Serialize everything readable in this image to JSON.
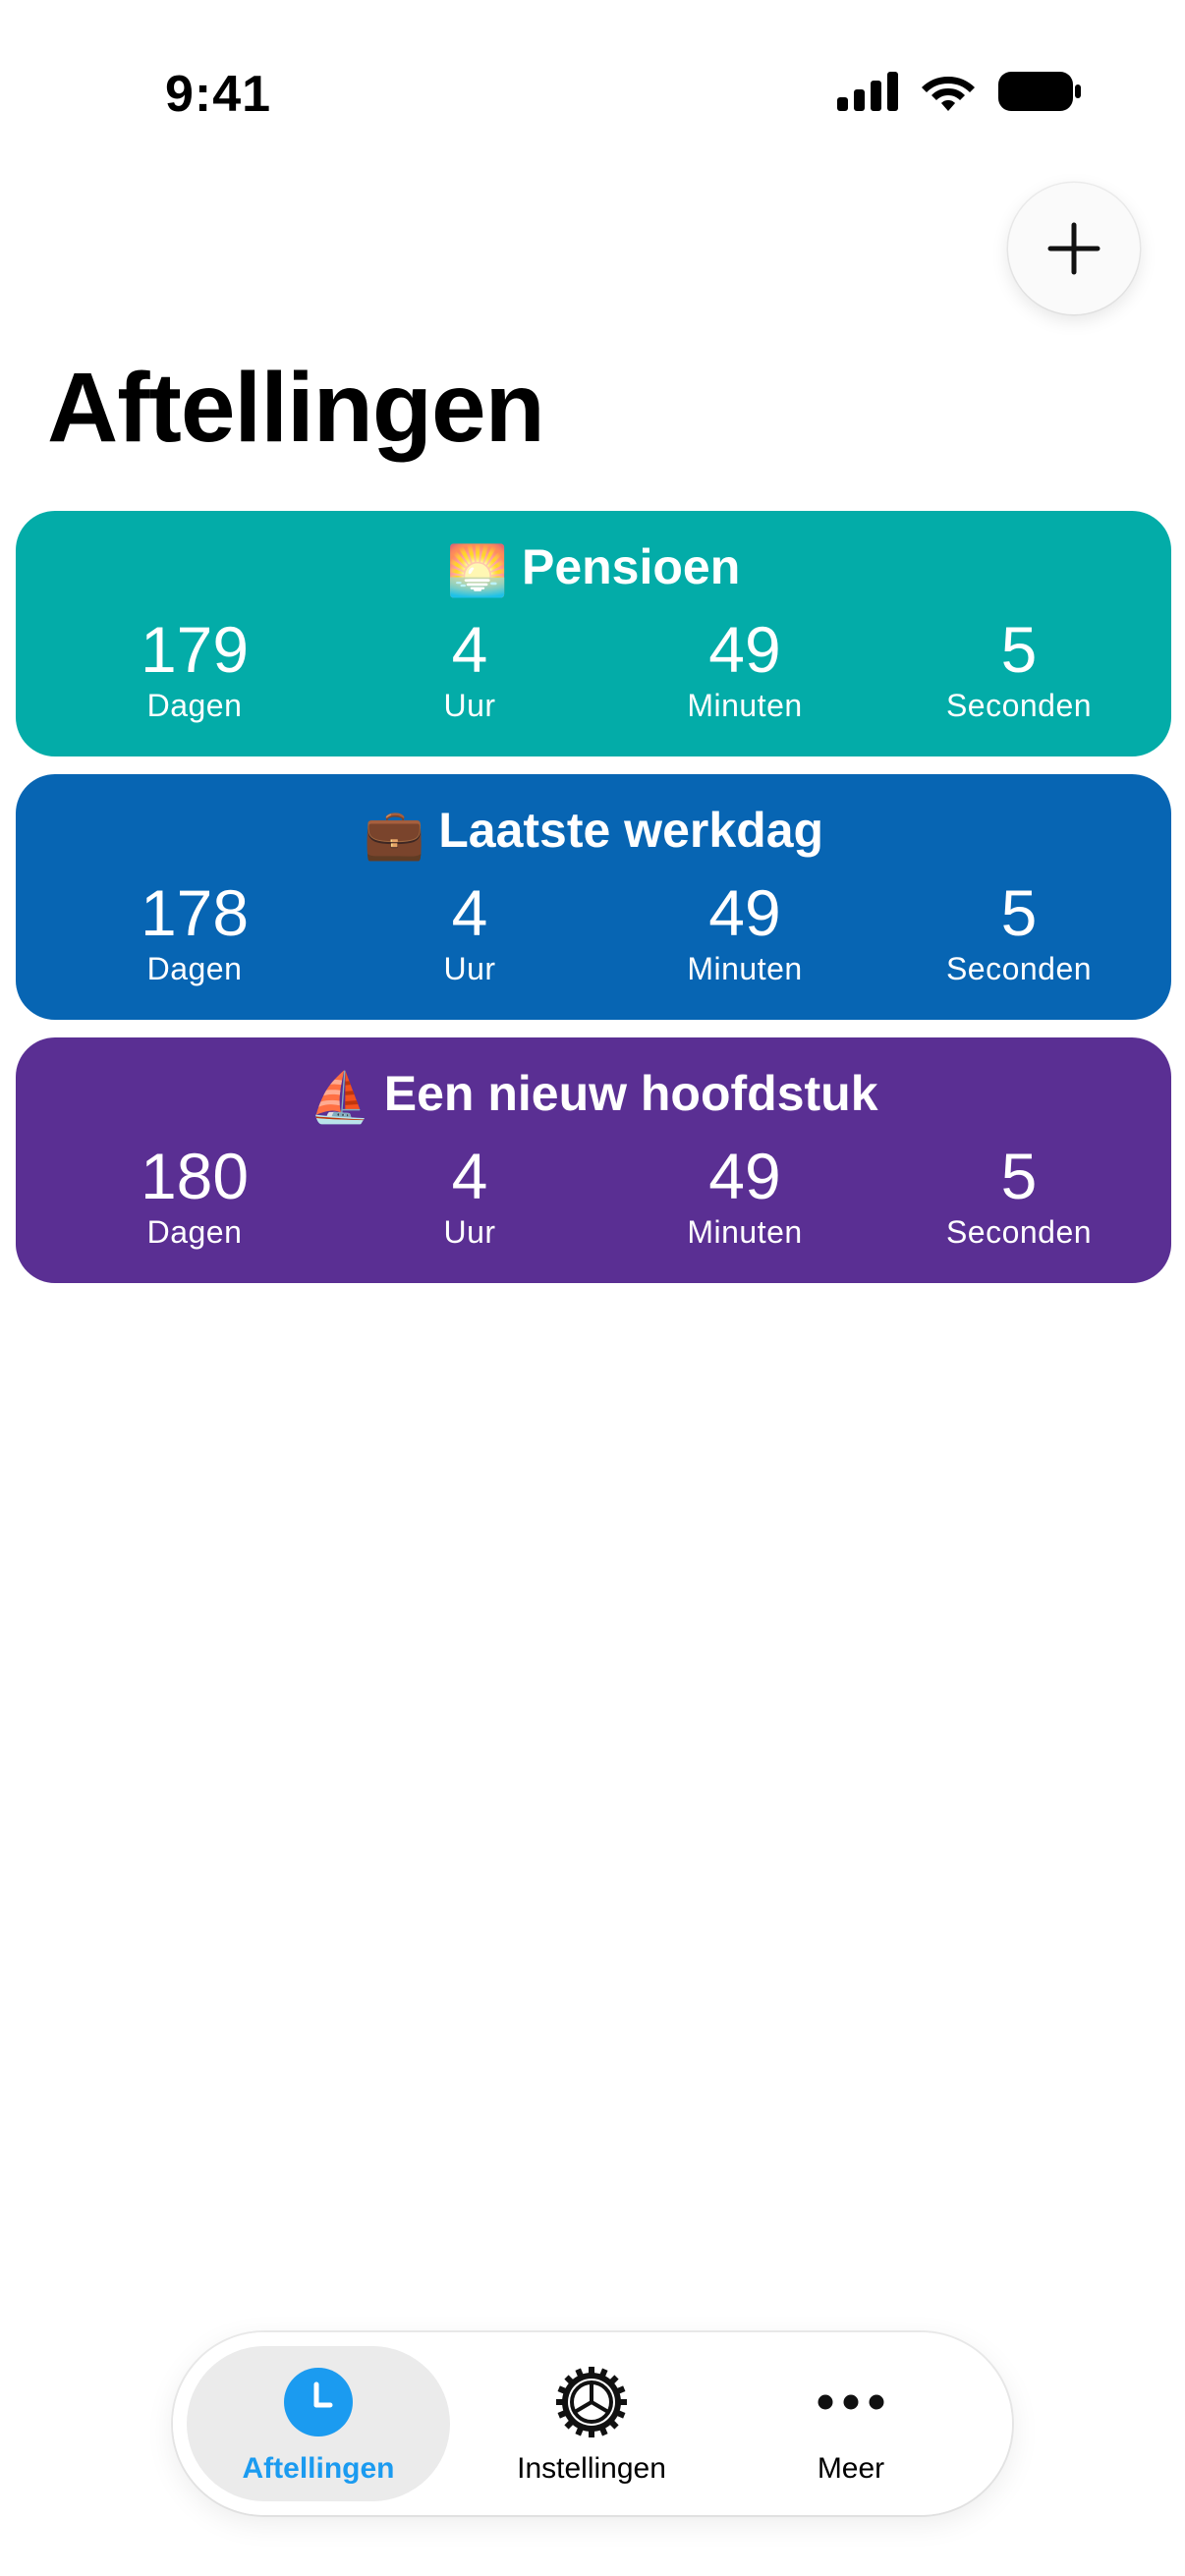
{
  "status_bar": {
    "time": "9:41"
  },
  "header": {
    "title": "Aftellingen",
    "add_icon": "plus-icon"
  },
  "countdowns": [
    {
      "emoji": "🌅",
      "title": "Pensioen",
      "color": "#03ACA8",
      "units": [
        {
          "value": "179",
          "label": "Dagen"
        },
        {
          "value": "4",
          "label": "Uur"
        },
        {
          "value": "49",
          "label": "Minuten"
        },
        {
          "value": "5",
          "label": "Seconden"
        }
      ]
    },
    {
      "emoji": "💼",
      "title": "Laatste werkdag",
      "color": "#0765B3",
      "units": [
        {
          "value": "178",
          "label": "Dagen"
        },
        {
          "value": "4",
          "label": "Uur"
        },
        {
          "value": "49",
          "label": "Minuten"
        },
        {
          "value": "5",
          "label": "Seconden"
        }
      ]
    },
    {
      "emoji": "⛵",
      "title": "Een nieuw hoofdstuk",
      "color": "#5A2F93",
      "units": [
        {
          "value": "180",
          "label": "Dagen"
        },
        {
          "value": "4",
          "label": "Uur"
        },
        {
          "value": "49",
          "label": "Minuten"
        },
        {
          "value": "5",
          "label": "Seconden"
        }
      ]
    }
  ],
  "tab_bar": {
    "active_color": "#1B9BF0",
    "tabs": [
      {
        "label": "Aftellingen",
        "icon": "clock-icon",
        "active": true
      },
      {
        "label": "Instellingen",
        "icon": "gear-icon",
        "active": false
      },
      {
        "label": "Meer",
        "icon": "more-icon",
        "active": false
      }
    ]
  }
}
